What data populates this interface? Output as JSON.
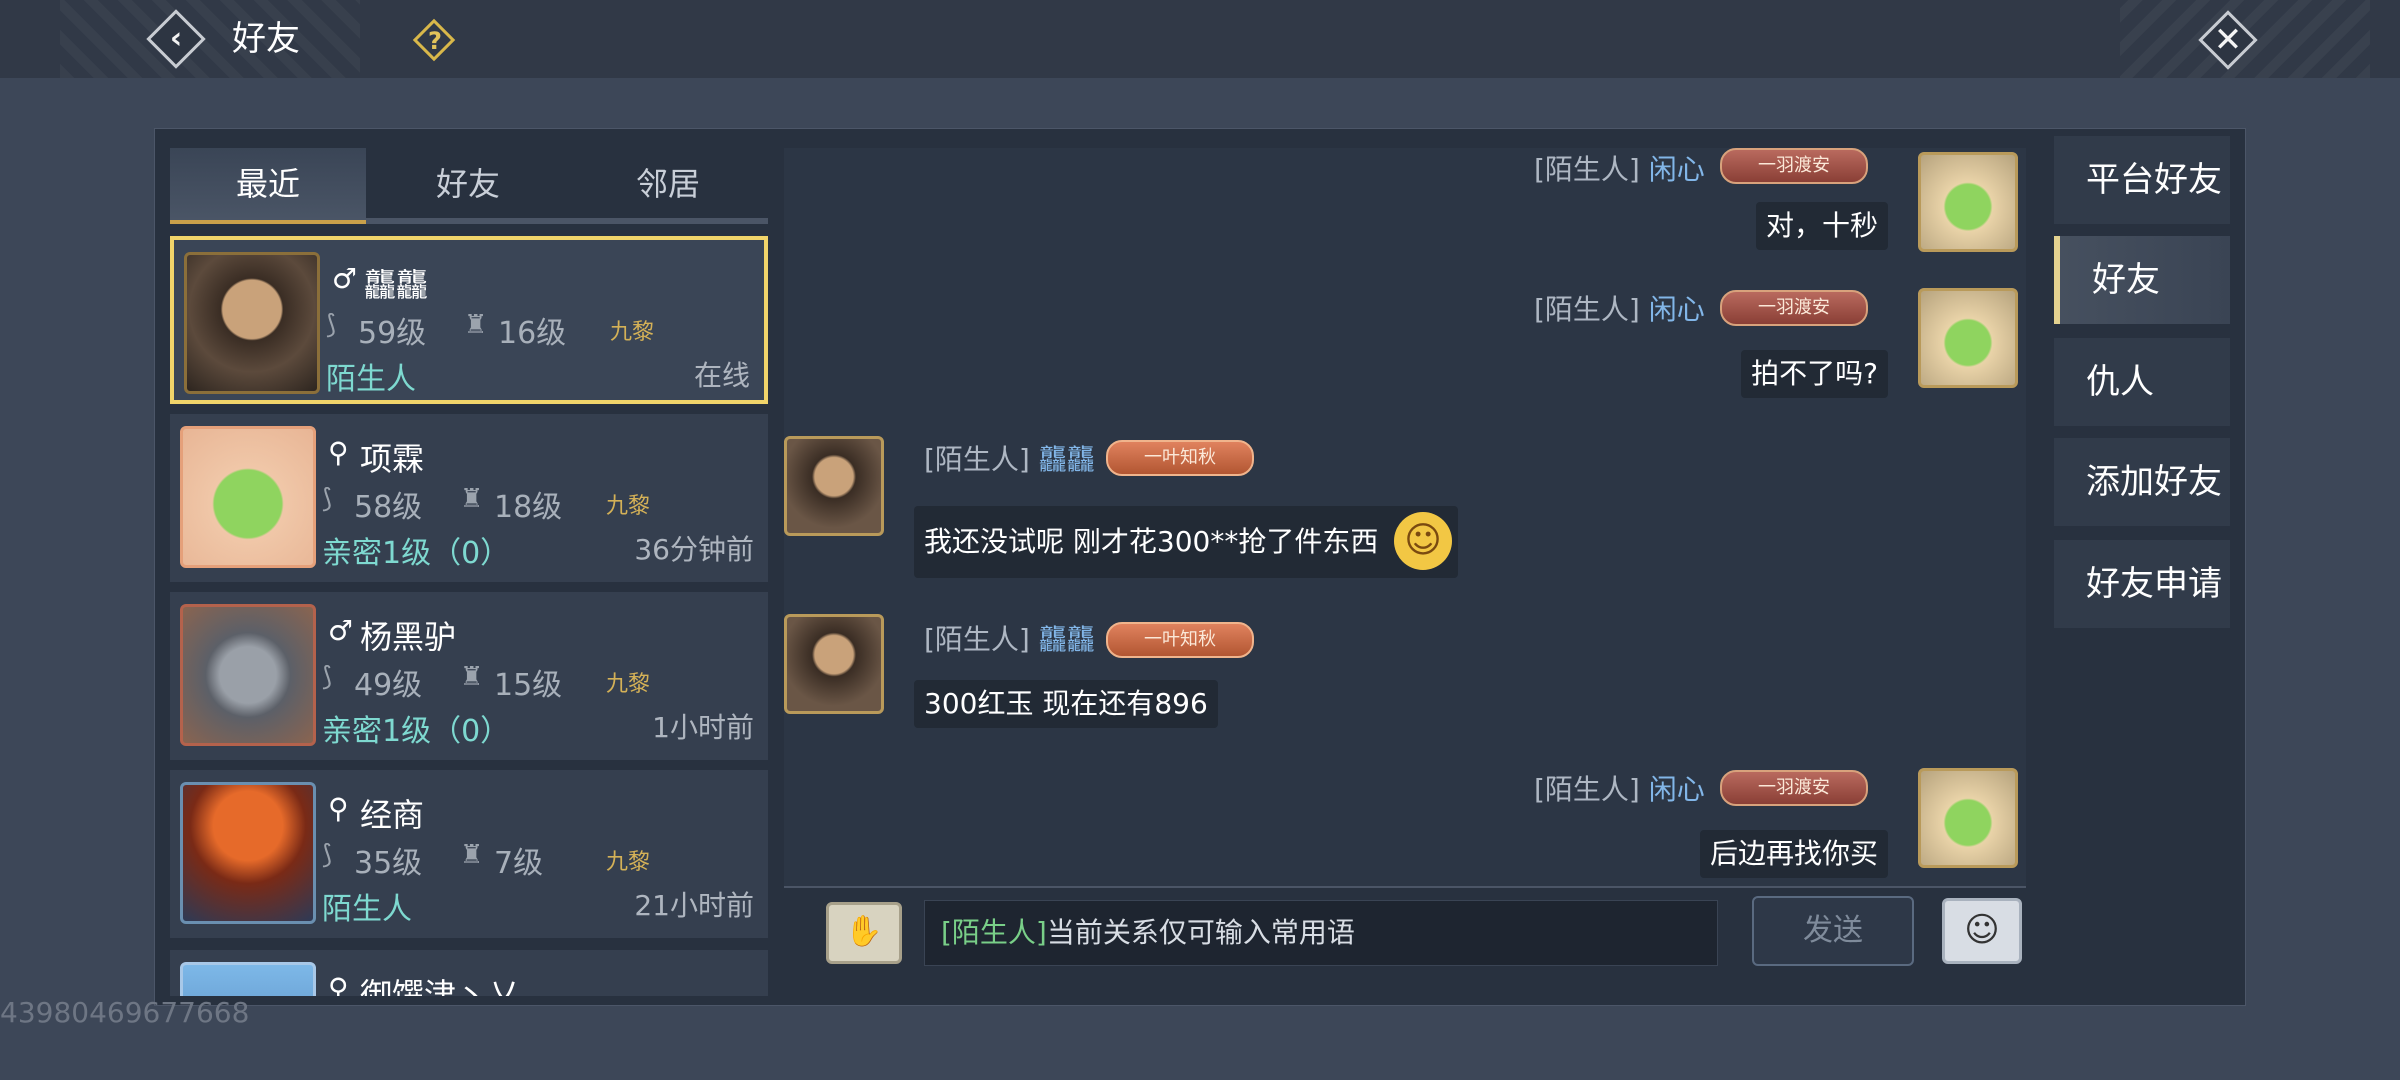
{
  "header": {
    "back_icon": "‹",
    "title": "好友",
    "help_icon": "?",
    "close_icon": "✕"
  },
  "tabs": [
    {
      "label": "最近",
      "active": true
    },
    {
      "label": "好友",
      "active": false
    },
    {
      "label": "邻居",
      "active": false
    }
  ],
  "friends": [
    {
      "gender": "♂",
      "name": "龘龘",
      "level": "59级",
      "rank": "16级",
      "tag": "九黎",
      "relation": "陌生人",
      "status": "在线"
    },
    {
      "gender": "⚲",
      "name": "项霖",
      "level": "58级",
      "rank": "18级",
      "tag": "九黎",
      "relation": "亲密1级（0）",
      "status": "36分钟前"
    },
    {
      "gender": "♂",
      "name": "杨黑驴",
      "level": "49级",
      "rank": "15级",
      "tag": "九黎",
      "relation": "亲密1级（0）",
      "status": "1小时前"
    },
    {
      "gender": "⚲",
      "name": "经商",
      "level": "35级",
      "rank": "7级",
      "tag": "九黎",
      "relation": "陌生人",
      "status": "21小时前"
    },
    {
      "gender": "⚲",
      "name": "御馔津丶乂"
    }
  ],
  "chat": {
    "messages": [
      {
        "side": "right",
        "stranger": "[陌生人]",
        "name": "闲心",
        "badge": "一羽渡安",
        "text": "对，十秒"
      },
      {
        "side": "right",
        "stranger": "[陌生人]",
        "name": "闲心",
        "badge": "一羽渡安",
        "text": "拍不了吗?"
      },
      {
        "side": "left",
        "stranger": "[陌生人]",
        "name": "龘龘",
        "badge": "一叶知秋",
        "text": "我还没试呢 刚才花300**抢了件东西"
      },
      {
        "side": "left",
        "stranger": "[陌生人]",
        "name": "龘龘",
        "badge": "一叶知秋",
        "text": "300红玉  现在还有896"
      },
      {
        "side": "right",
        "stranger": "[陌生人]",
        "name": "闲心",
        "badge": "一羽渡安",
        "text": "后边再找你买"
      }
    ],
    "input_prefix": "[陌生人]",
    "input_text": "当前关系仅可输入常用语",
    "send_label": "发送"
  },
  "menu": [
    {
      "label": "平台好友",
      "active": false
    },
    {
      "label": "好友",
      "active": true
    },
    {
      "label": "仇人",
      "active": false
    },
    {
      "label": "添加好友",
      "active": false
    },
    {
      "label": "好友申请",
      "active": false
    }
  ],
  "watermark": "43980469677668"
}
